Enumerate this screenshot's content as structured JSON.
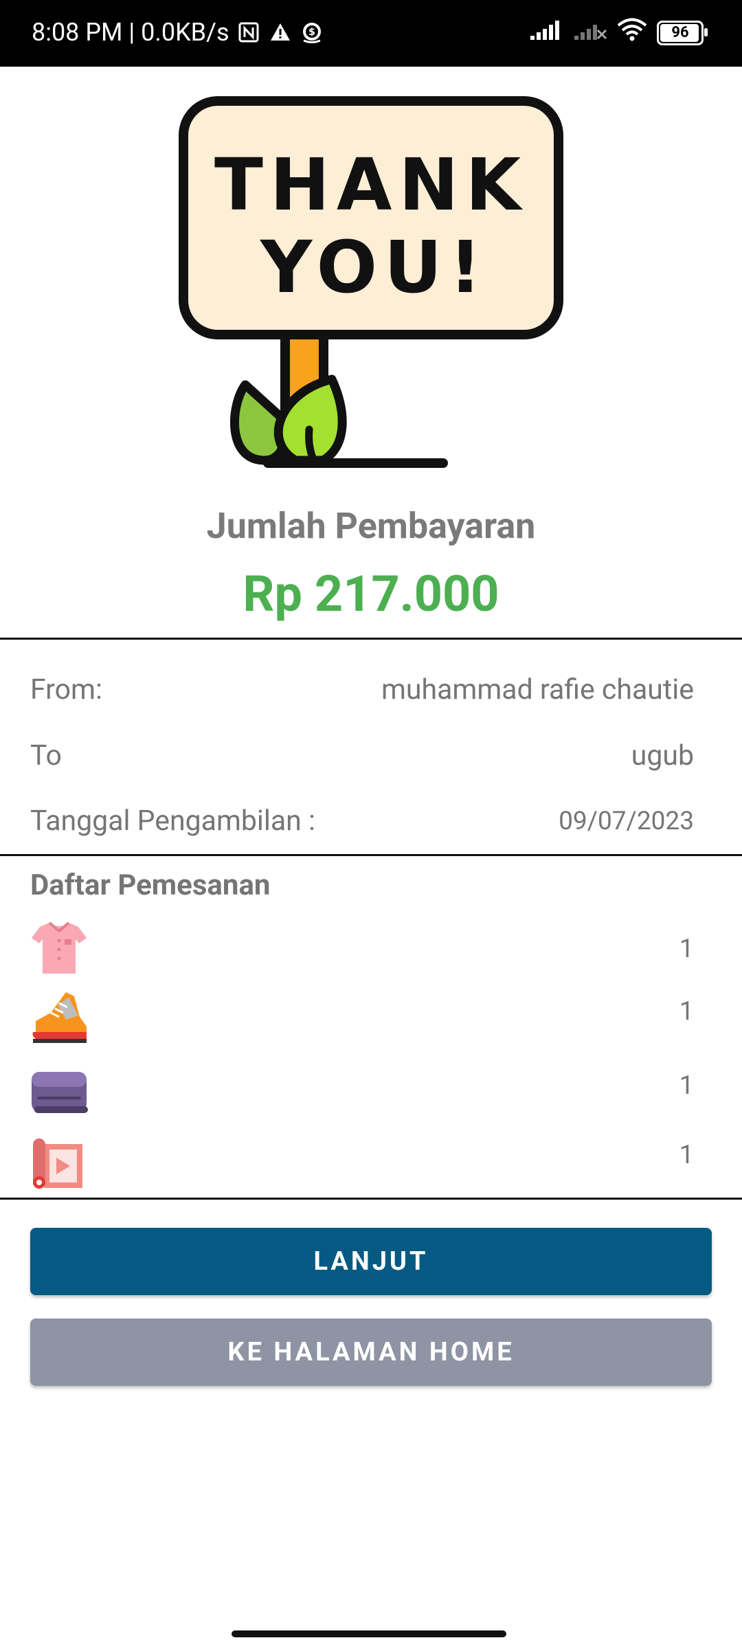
{
  "status_bar": {
    "time_speed": "8:08 PM | 0.0KB/s",
    "battery": "96",
    "battery_level_percent": 96,
    "icons": [
      "nfc-icon",
      "warning-icon",
      "money-app-icon",
      "signal-icon",
      "signal-empty-icon",
      "wifi-icon",
      "battery-icon"
    ]
  },
  "hero": {
    "sign_text_line1": "THANK",
    "sign_text_line2": "YOU!"
  },
  "payment": {
    "label": "Jumlah Pembayaran",
    "amount": "Rp 217.000",
    "amount_color": "#4caf50"
  },
  "details": {
    "from_label": "From:",
    "from_value": "muhammad rafie chautie",
    "to_label": "To",
    "to_value": "ugub",
    "date_label": "Tanggal Pengambilan :",
    "date_value": "09/07/2023"
  },
  "orders": {
    "title": "Daftar Pemesanan",
    "items": [
      {
        "icon": "shirt-icon",
        "qty": "1"
      },
      {
        "icon": "sneaker-icon",
        "qty": "1"
      },
      {
        "icon": "folded-blanket-icon",
        "qty": "1"
      },
      {
        "icon": "curtain-icon",
        "qty": "1"
      }
    ]
  },
  "buttons": {
    "primary": "LANJUT",
    "primary_color": "#045a82",
    "secondary": "KE HALAMAN HOME",
    "secondary_color": "#8e94a4"
  }
}
